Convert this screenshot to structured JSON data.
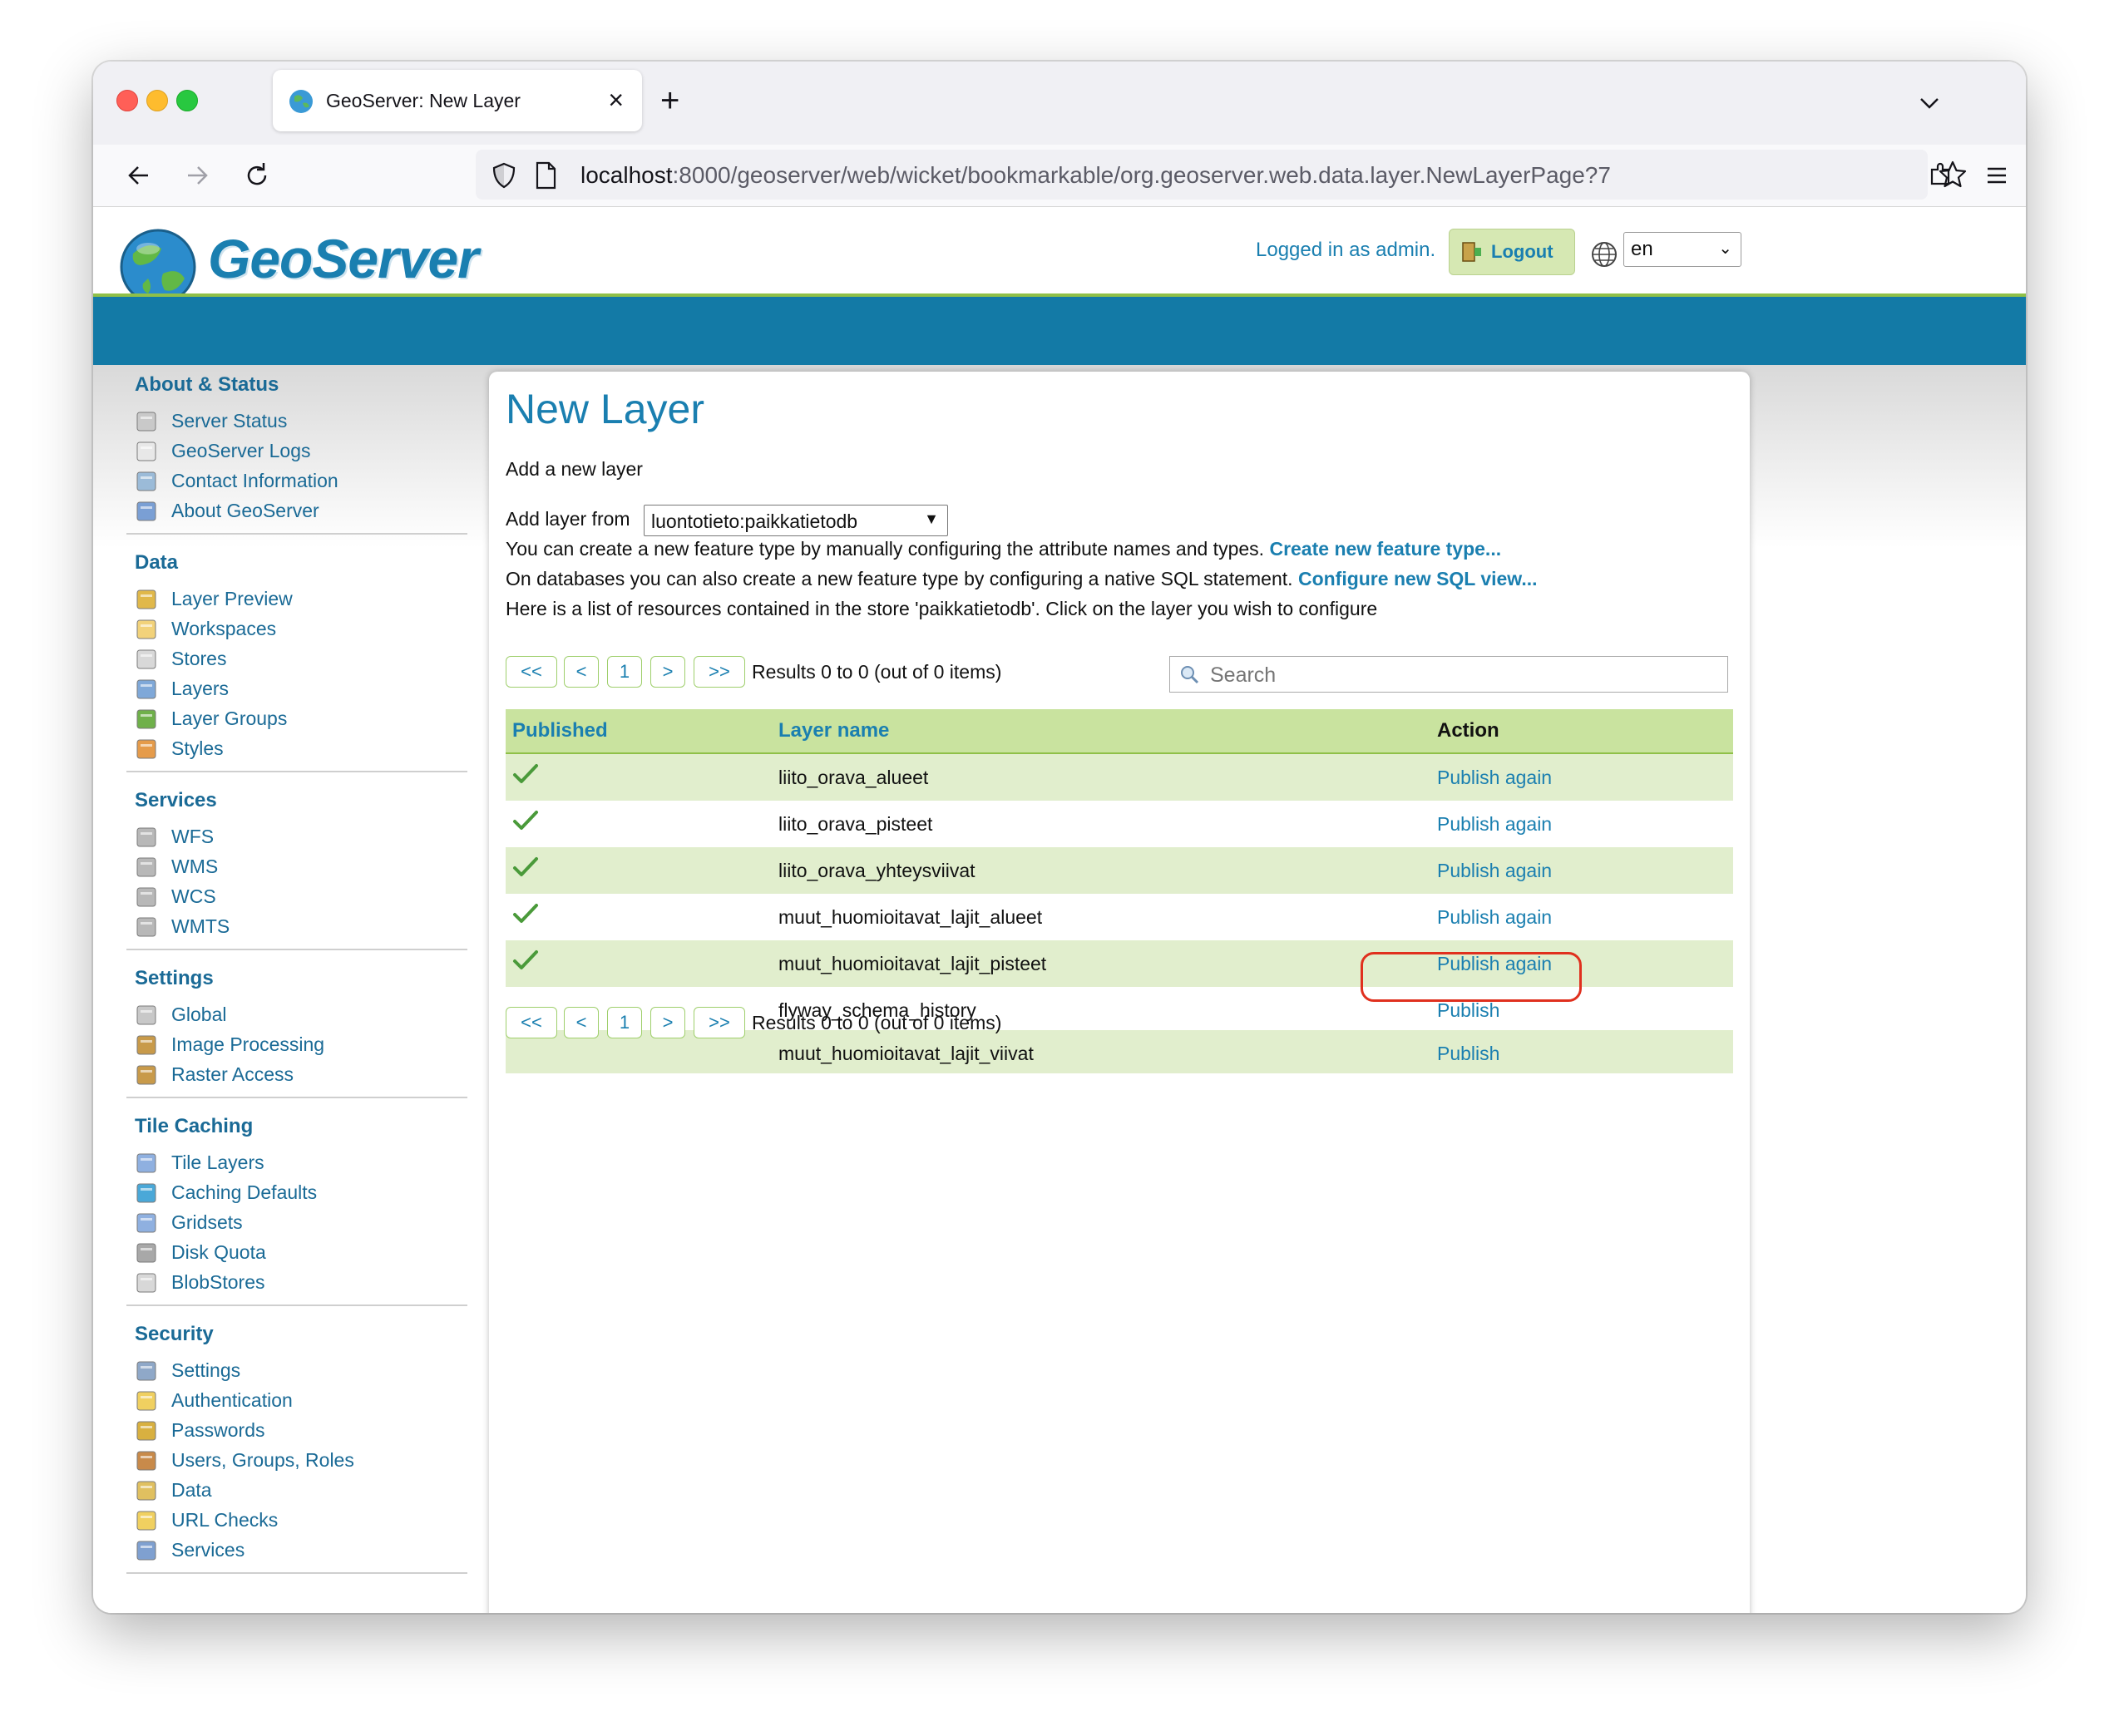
{
  "browser": {
    "tab_title": "GeoServer: New Layer",
    "new_tab": "+",
    "close_tab": "×",
    "url_host": "localhost",
    "url_rest": ":8000/geoserver/web/wicket/bookmarkable/org.geoserver.web.data.layer.NewLayerPage?7"
  },
  "header": {
    "logo_text": "GeoServer",
    "logged_in": "Logged in as admin.",
    "logout_label": "Logout",
    "language": "en"
  },
  "sidebar": {
    "sections": [
      {
        "title": "About & Status",
        "items": [
          {
            "label": "Server Status",
            "icon": "server-status-icon"
          },
          {
            "label": "GeoServer Logs",
            "icon": "logs-icon"
          },
          {
            "label": "Contact Information",
            "icon": "contact-icon"
          },
          {
            "label": "About GeoServer",
            "icon": "about-icon"
          }
        ]
      },
      {
        "title": "Data",
        "items": [
          {
            "label": "Layer Preview",
            "icon": "layer-preview-icon"
          },
          {
            "label": "Workspaces",
            "icon": "folder-icon"
          },
          {
            "label": "Stores",
            "icon": "database-icon"
          },
          {
            "label": "Layers",
            "icon": "layers-icon"
          },
          {
            "label": "Layer Groups",
            "icon": "layer-groups-icon"
          },
          {
            "label": "Styles",
            "icon": "palette-icon"
          }
        ]
      },
      {
        "title": "Services",
        "items": [
          {
            "label": "WFS",
            "icon": "service-icon"
          },
          {
            "label": "WMS",
            "icon": "service-icon"
          },
          {
            "label": "WCS",
            "icon": "service-icon"
          },
          {
            "label": "WMTS",
            "icon": "service-icon"
          }
        ]
      },
      {
        "title": "Settings",
        "items": [
          {
            "label": "Global",
            "icon": "server-icon"
          },
          {
            "label": "Image Processing",
            "icon": "image-icon"
          },
          {
            "label": "Raster Access",
            "icon": "image-icon"
          }
        ]
      },
      {
        "title": "Tile Caching",
        "items": [
          {
            "label": "Tile Layers",
            "icon": "grid-icon"
          },
          {
            "label": "Caching Defaults",
            "icon": "globe-icon"
          },
          {
            "label": "Gridsets",
            "icon": "grid-icon"
          },
          {
            "label": "Disk Quota",
            "icon": "disk-icon"
          },
          {
            "label": "BlobStores",
            "icon": "database-icon"
          }
        ]
      },
      {
        "title": "Security",
        "items": [
          {
            "label": "Settings",
            "icon": "wrench-icon"
          },
          {
            "label": "Authentication",
            "icon": "shield-icon"
          },
          {
            "label": "Passwords",
            "icon": "lock-icon"
          },
          {
            "label": "Users, Groups, Roles",
            "icon": "users-icon"
          },
          {
            "label": "Data",
            "icon": "data-security-icon"
          },
          {
            "label": "URL Checks",
            "icon": "shield-icon"
          },
          {
            "label": "Services",
            "icon": "services-security-icon"
          }
        ]
      }
    ]
  },
  "main": {
    "title": "New Layer",
    "subtitle": "Add a new layer",
    "add_layer_from_label": "Add layer from",
    "store_selected": "luontotieto:paikkatietodb",
    "line1_text": "You can create a new feature type by manually configuring the attribute names and types. ",
    "line1_link": "Create new feature type...",
    "line2_text": "On databases you can also create a new feature type by configuring a native SQL statement. ",
    "line2_link": "Configure new SQL view...",
    "line3_text": "Here is a list of resources contained in the store 'paikkatietodb'. Click on the layer you wish to configure",
    "pager": {
      "first": "<<",
      "prev": "<",
      "page": "1",
      "next": ">",
      "last": ">>",
      "results": "Results 0 to 0 (out of 0 items)"
    },
    "search_placeholder": "Search",
    "table": {
      "headers": {
        "published": "Published",
        "layer_name": "Layer name",
        "action": "Action"
      },
      "rows": [
        {
          "published": true,
          "name": "liito_orava_alueet",
          "action": "Publish again"
        },
        {
          "published": true,
          "name": "liito_orava_pisteet",
          "action": "Publish again"
        },
        {
          "published": true,
          "name": "liito_orava_yhteysviivat",
          "action": "Publish again"
        },
        {
          "published": true,
          "name": "muut_huomioitavat_lajit_alueet",
          "action": "Publish again"
        },
        {
          "published": true,
          "name": "muut_huomioitavat_lajit_pisteet",
          "action": "Publish again"
        },
        {
          "published": false,
          "name": "flyway_schema_history",
          "action": "Publish"
        },
        {
          "published": false,
          "name": "muut_huomioitavat_lajit_viivat",
          "action": "Publish"
        }
      ]
    }
  },
  "colors": {
    "brand_blue": "#1a7fb0",
    "band_blue": "#137aa6",
    "accent_green": "#8fc048",
    "highlight_red": "#e0301e"
  }
}
